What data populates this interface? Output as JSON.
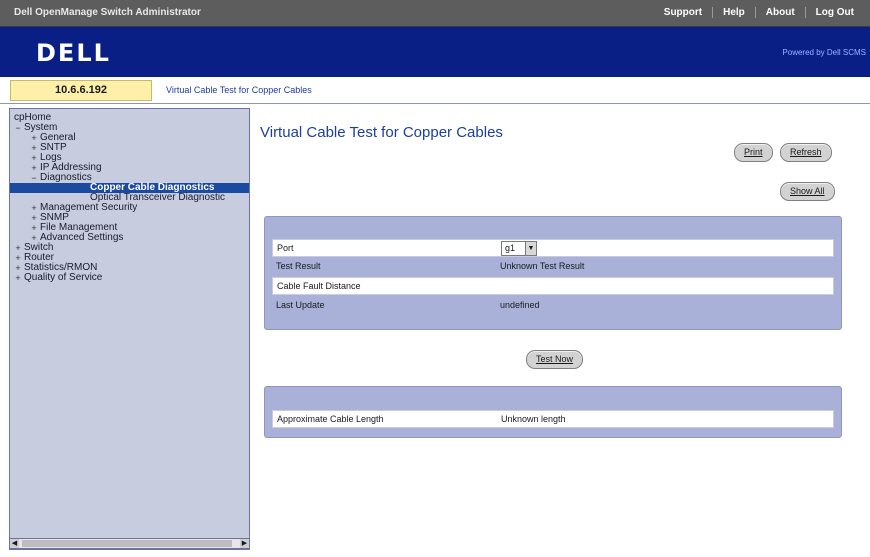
{
  "topbar": {
    "app_title": "Dell OpenManage Switch Administrator",
    "links": [
      "Support",
      "Help",
      "About",
      "Log Out"
    ]
  },
  "brand": {
    "logo": "DELL",
    "powered": "Powered by Dell SCMS"
  },
  "ipbar": {
    "ip": "10.6.6.192",
    "breadcrumb": "Virtual Cable Test for Copper Cables"
  },
  "tree": {
    "nodes": [
      {
        "label": "cpHome",
        "level": 0,
        "exp": ""
      },
      {
        "label": "System",
        "level": 1,
        "exp": "−"
      },
      {
        "label": "General",
        "level": 2,
        "exp": "+"
      },
      {
        "label": "SNTP",
        "level": 2,
        "exp": "+"
      },
      {
        "label": "Logs",
        "level": 2,
        "exp": "+"
      },
      {
        "label": "IP Addressing",
        "level": 2,
        "exp": "+"
      },
      {
        "label": "Diagnostics",
        "level": 2,
        "exp": "−"
      },
      {
        "label": "Copper Cable Diagnostics",
        "level": 3,
        "exp": "",
        "selected": true
      },
      {
        "label": "Optical Transceiver Diagnostic",
        "level": 3,
        "exp": ""
      },
      {
        "label": "Management Security",
        "level": 2,
        "exp": "+"
      },
      {
        "label": "SNMP",
        "level": 2,
        "exp": "+"
      },
      {
        "label": "File Management",
        "level": 2,
        "exp": "+"
      },
      {
        "label": "Advanced Settings",
        "level": 2,
        "exp": "+"
      },
      {
        "label": "Switch",
        "level": 1,
        "exp": "+"
      },
      {
        "label": "Router",
        "level": 1,
        "exp": "+"
      },
      {
        "label": "Statistics/RMON",
        "level": 1,
        "exp": "+"
      },
      {
        "label": "Quality of Service",
        "level": 1,
        "exp": "+"
      }
    ]
  },
  "main": {
    "title": "Virtual Cable Test for Copper Cables",
    "print_label": "Print",
    "refresh_label": "Refresh",
    "show_all_label": "Show All",
    "test_now_label": "Test Now"
  },
  "test_panel": {
    "port_label": "Port",
    "port_value": "g1",
    "result_label": "Test Result",
    "result_value": "Unknown Test Result",
    "fault_label": "Cable Fault Distance",
    "fault_value": "",
    "update_label": "Last Update",
    "update_value": "undefined"
  },
  "length_panel": {
    "length_label": "Approximate Cable Length",
    "length_value": "Unknown length"
  },
  "colors": {
    "topbar": "#5d5d5d",
    "brand": "#0a1f86",
    "panel": "#a9b1d9",
    "selected": "#1b4aa1",
    "title": "#1d3f9c"
  }
}
